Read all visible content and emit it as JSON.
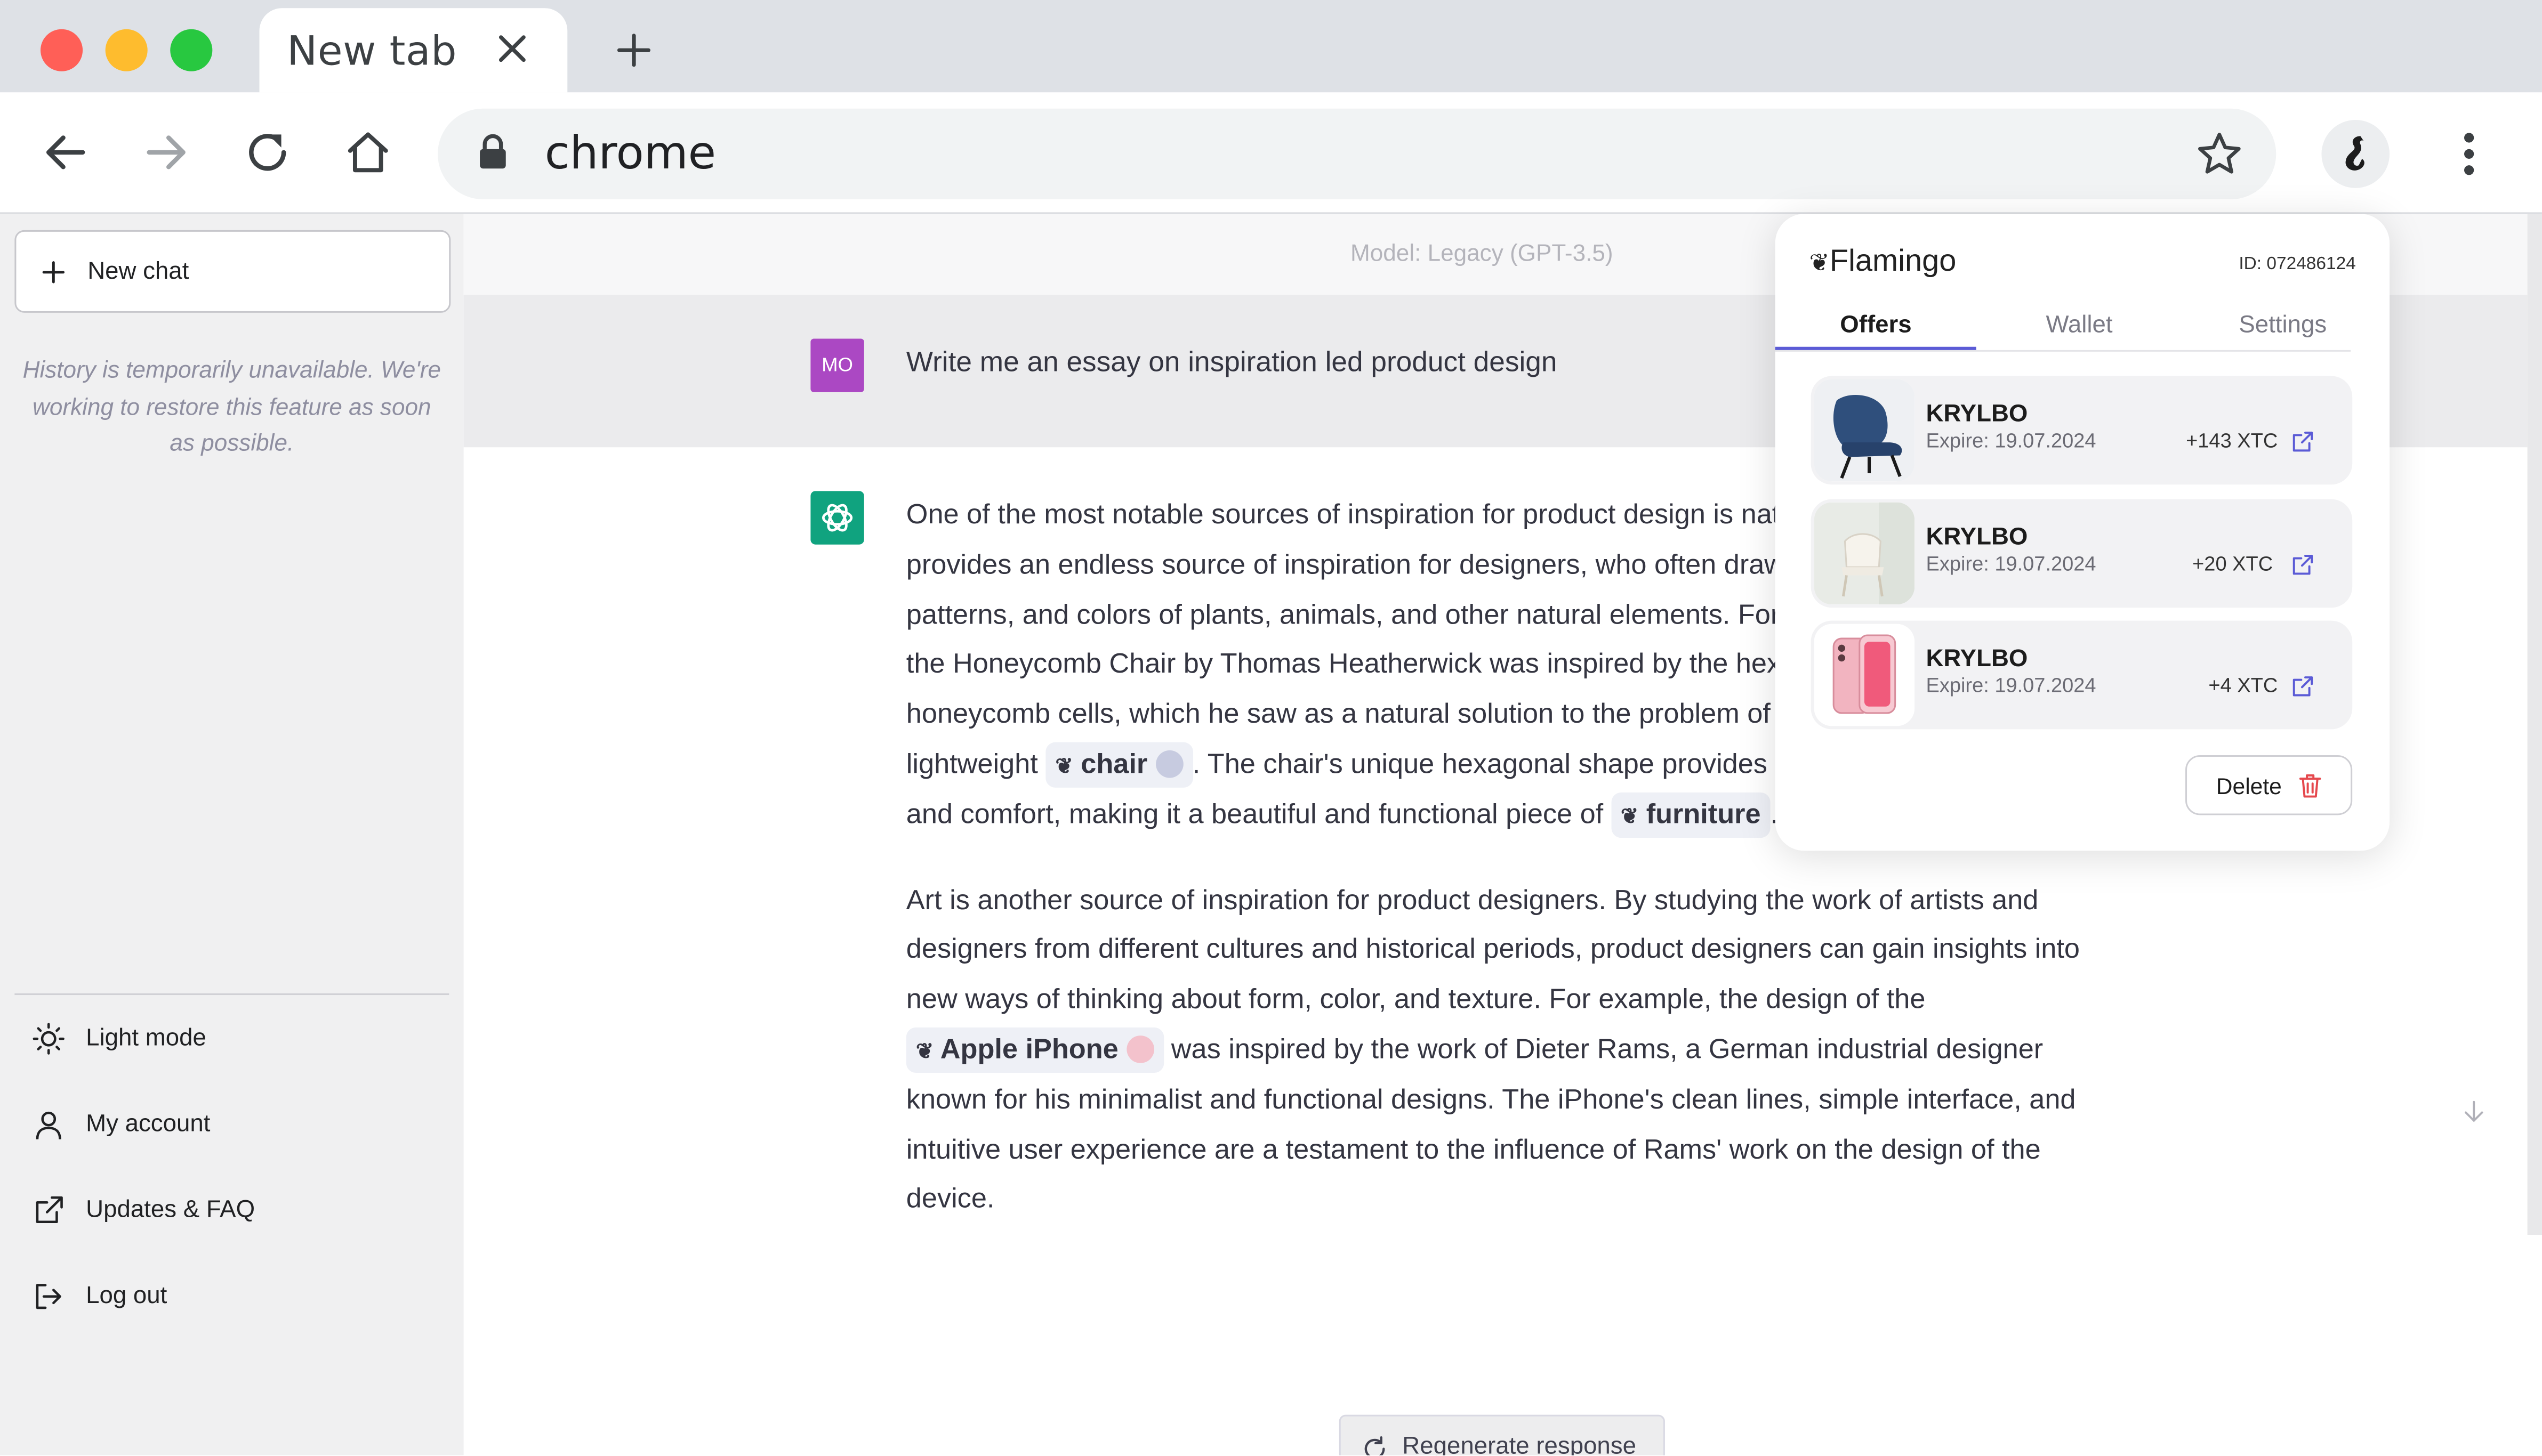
{
  "browser": {
    "tab_title": "New tab",
    "address": "chrome"
  },
  "sidebar": {
    "new_chat_label": "New chat",
    "history_note": "History is temporarily unavailable. We're working to restore this feature as soon as possible.",
    "items": [
      {
        "label": "Light mode",
        "icon": "sun-icon"
      },
      {
        "label": "My account",
        "icon": "user-icon"
      },
      {
        "label": "Updates & FAQ",
        "icon": "external-link-icon"
      },
      {
        "label": "Log out",
        "icon": "logout-icon"
      }
    ]
  },
  "chat": {
    "model_label": "Model: Legacy (GPT-3.5)",
    "user_initials": "MO",
    "user_message": "Write me an essay on inspiration led product design",
    "answer": {
      "p1_a": "One of the most notable sources of inspiration for product design is nature. The natural world provides an endless source of inspiration for designers, who often draw upon the shapes, patterns, and colors of plants, animals, and other natural elements. For example, the design of the Honeycomb Chair by Thomas Heatherwick was inspired by the hexagonal shape of honeycomb cells, which he saw as a natural solution to the problem of creating a strong, lightweight",
      "chip_chair": "chair",
      "p1_b": ". The chair's unique hexagonal shape provides both structural support and comfort, making it a beautiful and functional piece of",
      "chip_furniture": "furniture",
      "p1_c": ".",
      "p2_a": "Art is another source of inspiration for product designers. By studying the work of artists and designers from different cultures and historical periods, product designers can gain insights into new ways of thinking about form, color, and texture. For example, the design of the",
      "chip_iphone": "Apple iPhone",
      "p2_b": "was inspired by the work of Dieter Rams, a German industrial designer known for his minimalist and functional designs. The iPhone's clean lines, simple interface, and intuitive user experience are a testament to the influence of Rams' work on the design of the device."
    },
    "regenerate_label": "Regenerate response"
  },
  "extension": {
    "brand": "Flamingo",
    "id_label": "ID: 072486124",
    "tabs": [
      "Offers",
      "Wallet",
      "Settings"
    ],
    "active_tab": "Offers",
    "offers": [
      {
        "name": "KRYLBO",
        "expire": "Expire: 19.07.2024",
        "amount": "+143 XTC",
        "image": "blue-chair"
      },
      {
        "name": "KRYLBO",
        "expire": "Expire: 19.07.2024",
        "amount": "+20 XTC",
        "image": "white-chair"
      },
      {
        "name": "KRYLBO",
        "expire": "Expire: 19.07.2024",
        "amount": "+4 XTC",
        "image": "pink-iphone"
      }
    ],
    "delete_label": "Delete"
  },
  "colors": {
    "accent": "#5b5bd6",
    "user_avatar": "#ab48c3",
    "ai_avatar": "#10a37f",
    "delete_icon": "#e5484d"
  }
}
